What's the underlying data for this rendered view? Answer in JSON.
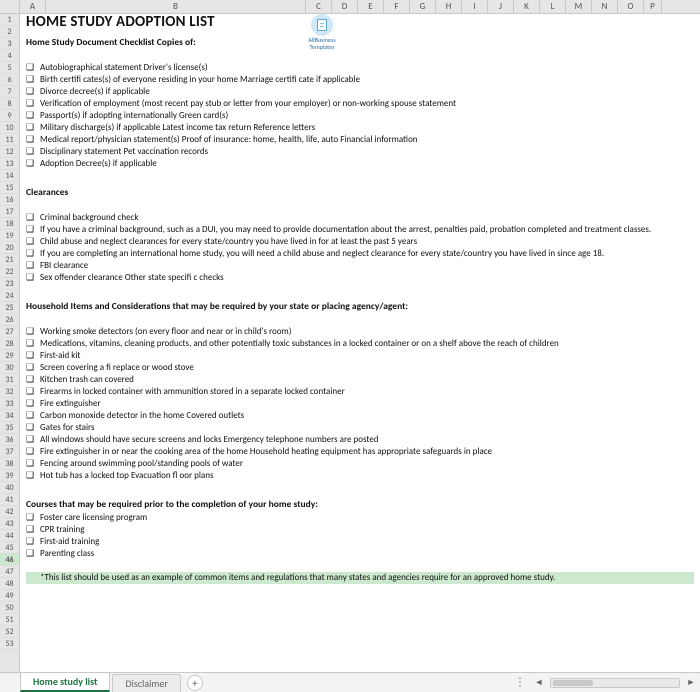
{
  "columns": [
    "A",
    "B",
    "C",
    "D",
    "E",
    "F",
    "G",
    "H",
    "I",
    "J",
    "K",
    "L",
    "M",
    "N",
    "O",
    "P"
  ],
  "row_count": 53,
  "selected_row": 46,
  "title": "HOME STUDY ADOPTION LIST",
  "logo_text": "AllBusiness Templates",
  "sections": {
    "s1": {
      "heading": "Home Study Document Checklist Copies of:",
      "items": [
        "Autobiographical statement Driver's license(s)",
        "Birth certifi cates(s) of everyone residing in your home Marriage certifi cate if applicable",
        "Divorce decree(s) if applicable",
        "Verification of employment (most recent pay stub or letter from your employer) or non-working spouse statement",
        "Passport(s) if adopting internationally Green card(s)",
        "Military discharge(s) if applicable Latest income tax return Reference letters",
        "Medical report/physician statement(s) Proof of insurance: home, health, life, auto Financial information",
        "Disciplinary statement Pet vaccination records",
        "Adoption Decree(s) if applicable"
      ]
    },
    "s2": {
      "heading": "Clearances",
      "items": [
        "Criminal background check",
        "If you have a criminal background, such as a DUI, you may need to provide documentation about the arrest, penalties paid, probation completed and treatment classes.",
        "Child abuse and neglect clearances for every state/country you have lived in for at least the past 5 years",
        "If you are completing an international home study, you will need a child abuse and neglect clearance for every state/country you have lived in since age 18.",
        "FBI clearance",
        "Sex offender clearance Other state specifi c checks"
      ]
    },
    "s3": {
      "heading": "Household Items and Considerations that may be required by your state or placing agency/agent:",
      "items": [
        "Working smoke detectors (on every floor and near or in child's room)",
        "Medications, vitamins, cleaning products, and other potentially toxic substances in a locked container or on a shelf above the reach of children",
        "First-aid kit",
        "Screen covering a fi replace or wood stove",
        "Kitchen trash can covered",
        "Firearms in locked container with ammunition stored in a separate locked container",
        "Fire extinguisher",
        "Carbon monoxide detector in the home Covered outlets",
        "Gates for stairs",
        "All windows should have secure screens and locks Emergency telephone numbers are posted",
        "Fire extinguisher in or near the cooking area of the home Household heating equipment has appropriate safeguards in place",
        "Fencing around swimming pool/standing pools of water",
        "Hot tub has a locked top Evacuation fl oor plans"
      ]
    },
    "s4": {
      "heading": "Courses that may be required prior to the completion of your home study:",
      "items": [
        "Foster care licensing program",
        "CPR training",
        "First-aid training",
        "Parenting class"
      ]
    }
  },
  "footnote": "*This list should be used as an example of common items and regulations that many states and agencies require for an approved home study.",
  "checkbox_glyph": "❑",
  "tabs": {
    "active": "Home study list",
    "inactive": "Disclaimer",
    "add": "+"
  }
}
